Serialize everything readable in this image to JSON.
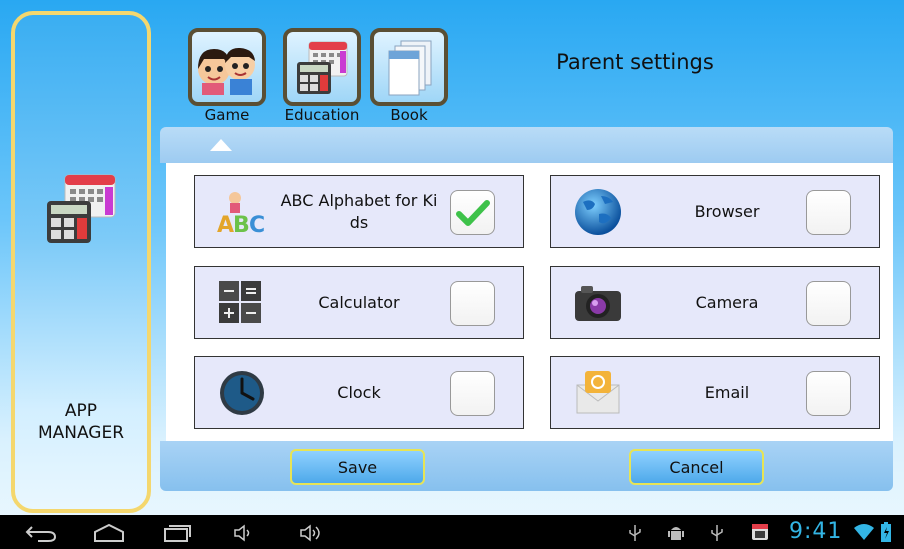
{
  "side_panel": {
    "label_line1": "APP",
    "label_line2": "MANAGER",
    "icon": "app-manager-icon"
  },
  "tabs": [
    {
      "label": "Game",
      "icon": "kids-faces-icon"
    },
    {
      "label": "Education",
      "icon": "calculator-calendar-icon"
    },
    {
      "label": "Book",
      "icon": "book-icon"
    }
  ],
  "page_title": "Parent settings",
  "apps": [
    {
      "name": "ABC Alphabet for Ki ds",
      "icon": "abc-alphabet-icon",
      "checked": true
    },
    {
      "name": "Browser",
      "icon": "globe-icon",
      "checked": false
    },
    {
      "name": "Calculator",
      "icon": "calculator-icon",
      "checked": false
    },
    {
      "name": "Camera",
      "icon": "camera-icon",
      "checked": false
    },
    {
      "name": "Clock",
      "icon": "clock-icon",
      "checked": false
    },
    {
      "name": "Email",
      "icon": "email-icon",
      "checked": false
    }
  ],
  "buttons": {
    "save": "Save",
    "cancel": "Cancel"
  },
  "status_bar": {
    "time": "9:41"
  },
  "colors": {
    "accent_blue": "#33b5e5",
    "check_green": "#3ec24a",
    "panel_border": "#f4d76e",
    "button_border": "#e7e455"
  }
}
